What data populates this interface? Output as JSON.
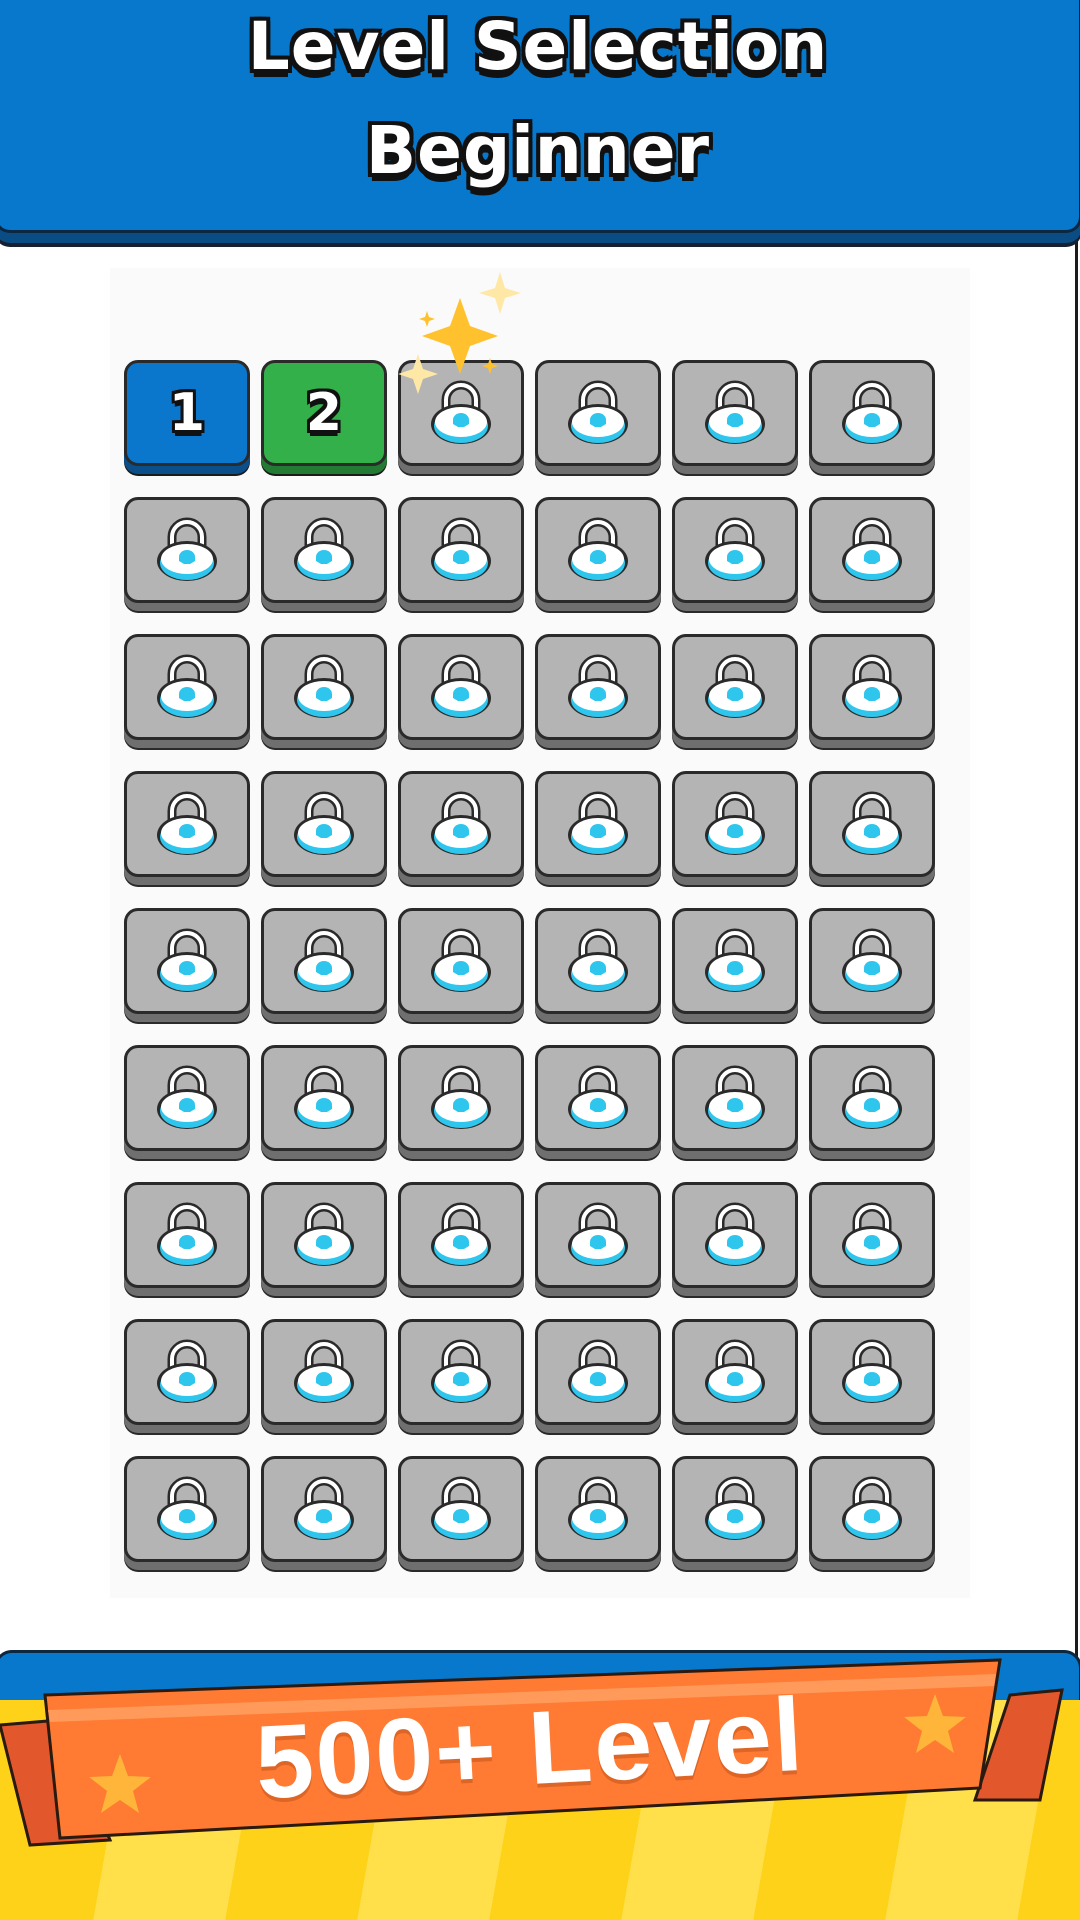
{
  "header": {
    "title": "Level Selection",
    "subtitle": "Beginner"
  },
  "levels": {
    "unlocked": [
      {
        "label": "1",
        "color": "#0b77cc"
      },
      {
        "label": "2",
        "color": "#34b04a"
      }
    ],
    "locked_count": 52,
    "locked_color": "#b4b4b4",
    "lock_icon": "padlock-icon"
  },
  "banner": {
    "text": "500+ Level",
    "color": "#ff7a33",
    "star_icon": "star-icon"
  },
  "colors": {
    "header_blue": "#0878cc",
    "stripe_yellow": "#ffd21a"
  }
}
